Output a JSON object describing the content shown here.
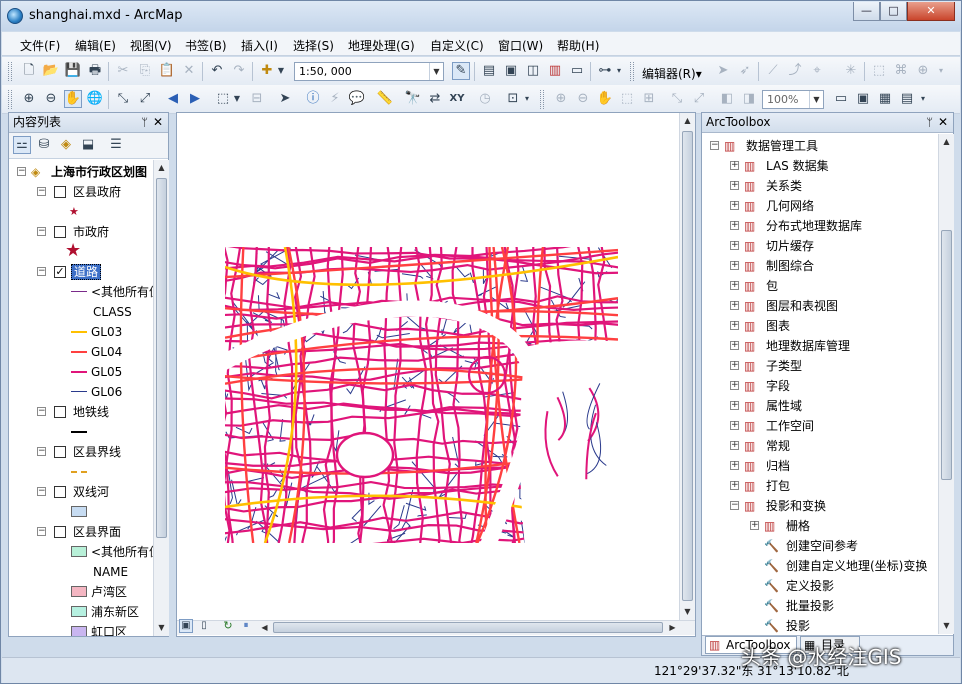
{
  "window": {
    "title": "shanghai.mxd - ArcMap",
    "min": "—",
    "max": "□",
    "close": "✕"
  },
  "menu": [
    "文件(F)",
    "编辑(E)",
    "视图(V)",
    "书签(B)",
    "插入(I)",
    "选择(S)",
    "地理处理(G)",
    "自定义(C)",
    "窗口(W)",
    "帮助(H)"
  ],
  "toolbar": {
    "scale": "1:50, 000",
    "editor": "编辑器(R)▾",
    "zoom": "100%"
  },
  "toc": {
    "title": "内容列表",
    "pin": "ᛘ",
    "close": "✕",
    "dataframe": "上海市行政区划图",
    "layers": [
      {
        "name": "区县政府",
        "checked": false
      },
      {
        "name": "市政府",
        "checked": false
      },
      {
        "name": "道路",
        "checked": true
      },
      {
        "name": "地铁线",
        "checked": false
      },
      {
        "name": "区县界线",
        "checked": false
      },
      {
        "name": "双线河",
        "checked": false
      },
      {
        "name": "区县界面",
        "checked": false
      }
    ],
    "road_legend": {
      "other": "<其他所有值>",
      "field": "CLASS",
      "classes": [
        {
          "label": "GL03",
          "color": "#ffc000"
        },
        {
          "label": "GL04",
          "color": "#ff4040"
        },
        {
          "label": "GL05",
          "color": "#e0157a"
        },
        {
          "label": "GL06",
          "color": "#2a3a8c"
        }
      ]
    },
    "district_legend": {
      "other": "<其他所有值>",
      "field": "NAME",
      "items": [
        {
          "label": "卢湾区",
          "color": "#f4b6c2"
        },
        {
          "label": "浦东新区",
          "color": "#b6f0e0"
        },
        {
          "label": "虹口区",
          "color": "#c9b6f0"
        }
      ]
    }
  },
  "toolbox": {
    "title": "ArcToolbox",
    "pin": "ᛘ",
    "close": "✕",
    "root": "数据管理工具",
    "sets": [
      "LAS 数据集",
      "关系类",
      "几何网络",
      "分布式地理数据库",
      "切片缓存",
      "制图综合",
      "包",
      "图层和表视图",
      "图表",
      "地理数据库管理",
      "子类型",
      "字段",
      "属性域",
      "工作空间",
      "常规",
      "归档",
      "打包",
      "投影和变换"
    ],
    "sub_set": "栅格",
    "tools": [
      "创建空间参考",
      "创建自定义地理(坐标)变换",
      "定义投影",
      "批量投影",
      "投影"
    ],
    "tabs": [
      "ArcToolbox",
      "目录"
    ]
  },
  "status": {
    "coords": "121°29'37.32\"东  31°13'10.82\"北"
  },
  "watermark": "头条 @水经注GIS"
}
